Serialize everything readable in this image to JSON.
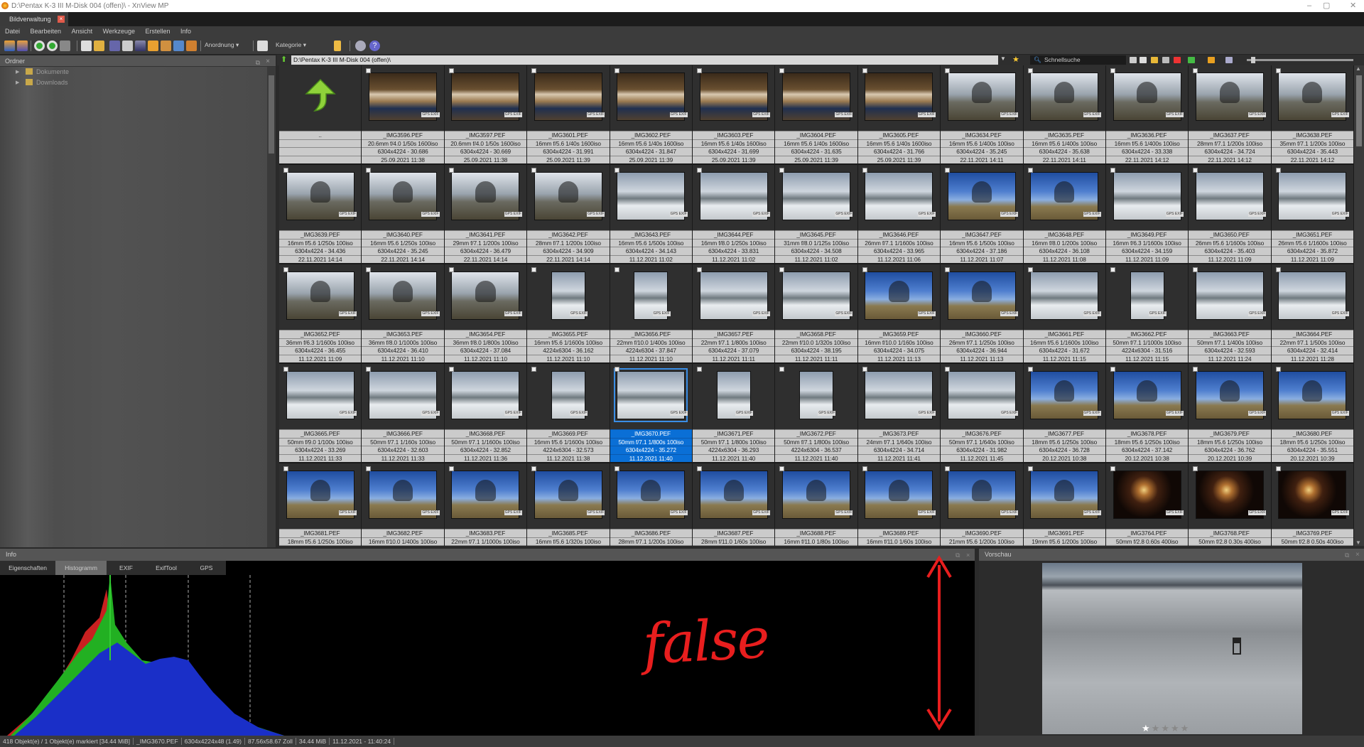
{
  "window": {
    "title": "D:\\Pentax K-3 III M-Disk 004 (offen)\\ - XnView MP",
    "minimize": "–",
    "maximize": "▢",
    "close": "✕"
  },
  "tab": {
    "label": "Bildverwaltung",
    "close": "×"
  },
  "menu": [
    "Datei",
    "Bearbeiten",
    "Ansicht",
    "Werkzeuge",
    "Erstellen",
    "Info"
  ],
  "toolbar": {
    "arrange_label": "Anordnung ▾",
    "category_label": "Kategorie ▾"
  },
  "folders": {
    "title": "Ordner",
    "items": [
      "Dokumente",
      "Downloads"
    ]
  },
  "pathbar": {
    "path": "D:\\Pentax K-3 III M-Disk 004 (offen)\\",
    "search_placeholder": "Schnellsuche"
  },
  "browser": {
    "parent_label": "..",
    "selected": "_IMG3670.PEF",
    "items": [
      [
        "_IMG3596.PEF",
        "20.6mm f/4.0 1/50s 1600iso",
        "6304x4224 - 30.686",
        "25.09.2021 11:38"
      ],
      [
        "_IMG3597.PEF",
        "20.6mm f/4.0 1/50s 1600iso",
        "6304x4224 - 30.669",
        "25.09.2021 11:38"
      ],
      [
        "_IMG3601.PEF",
        "16mm f/5.6 1/40s 1600iso",
        "6304x4224 - 31.991",
        "25.09.2021 11:39"
      ],
      [
        "_IMG3602.PEF",
        "16mm f/5.6 1/40s 1600iso",
        "6304x4224 - 31.847",
        "25.09.2021 11:39"
      ],
      [
        "_IMG3603.PEF",
        "16mm f/5.6 1/40s 1600iso",
        "6304x4224 - 31.699",
        "25.09.2021 11:39"
      ],
      [
        "_IMG3604.PEF",
        "16mm f/5.6 1/40s 1600iso",
        "6304x4224 - 31.635",
        "25.09.2021 11:39"
      ],
      [
        "_IMG3605.PEF",
        "16mm f/5.6 1/40s 1600iso",
        "6304x4224 - 31.766",
        "25.09.2021 11:39"
      ],
      [
        "_IMG3634.PEF",
        "16mm f/5.6 1/400s 100iso",
        "6304x4224 - 35.245",
        "22.11.2021 14:11"
      ],
      [
        "_IMG3635.PEF",
        "16mm f/5.6 1/400s 100iso",
        "6304x4224 - 35.638",
        "22.11.2021 14:11"
      ],
      [
        "_IMG3636.PEF",
        "16mm f/5.6 1/400s 100iso",
        "6304x4224 - 33.338",
        "22.11.2021 14:12"
      ],
      [
        "_IMG3637.PEF",
        "28mm f/7.1 1/200s 100iso",
        "6304x4224 - 34.724",
        "22.11.2021 14:12"
      ],
      [
        "_IMG3638.PEF",
        "35mm f/7.1 1/200s 100iso",
        "6304x4224 - 35.443",
        "22.11.2021 14:12"
      ],
      [
        "_IMG3639.PEF",
        "16mm f/5.6 1/250s 100iso",
        "6304x4224 - 34.436",
        "22.11.2021 14:14"
      ],
      [
        "_IMG3640.PEF",
        "16mm f/5.6 1/250s 100iso",
        "6304x4224 - 35.245",
        "22.11.2021 14:14"
      ],
      [
        "_IMG3641.PEF",
        "29mm f/7.1 1/200s 100iso",
        "6304x4224 - 36.479",
        "22.11.2021 14:14"
      ],
      [
        "_IMG3642.PEF",
        "28mm f/7.1 1/200s 100iso",
        "6304x4224 - 34.909",
        "22.11.2021 14:14"
      ],
      [
        "_IMG3643.PEF",
        "16mm f/5.6 1/500s 100iso",
        "6304x4224 - 34.143",
        "11.12.2021 11:02"
      ],
      [
        "_IMG3644.PEF",
        "16mm f/8.0 1/250s 100iso",
        "6304x4224 - 33.831",
        "11.12.2021 11:02"
      ],
      [
        "_IMG3645.PEF",
        "31mm f/8.0 1/125s 100iso",
        "6304x4224 - 34.508",
        "11.12.2021 11:02"
      ],
      [
        "_IMG3646.PEF",
        "26mm f/7.1 1/1600s 100iso",
        "6304x4224 - 33.965",
        "11.12.2021 11:06"
      ],
      [
        "_IMG3647.PEF",
        "16mm f/5.6 1/500s 100iso",
        "6304x4224 - 37.186",
        "11.12.2021 11:07"
      ],
      [
        "_IMG3648.PEF",
        "16mm f/8.0 1/200s 100iso",
        "6304x4224 - 36.108",
        "11.12.2021 11:08"
      ],
      [
        "_IMG3649.PEF",
        "16mm f/6.3 1/1600s 100iso",
        "6304x4224 - 34.159",
        "11.12.2021 11:09"
      ],
      [
        "_IMG3650.PEF",
        "26mm f/5.6 1/1600s 100iso",
        "6304x4224 - 35.403",
        "11.12.2021 11:09"
      ],
      [
        "_IMG3651.PEF",
        "26mm f/5.6 1/1600s 100iso",
        "6304x4224 - 35.872",
        "11.12.2021 11:09"
      ],
      [
        "_IMG3652.PEF",
        "36mm f/6.3 1/1600s 100iso",
        "6304x4224 - 36.455",
        "11.12.2021 11:09"
      ],
      [
        "_IMG3653.PEF",
        "36mm f/8.0 1/1000s 100iso",
        "6304x4224 - 36.410",
        "11.12.2021 11:10"
      ],
      [
        "_IMG3654.PEF",
        "36mm f/8.0 1/800s 100iso",
        "6304x4224 - 37.084",
        "11.12.2021 11:10"
      ],
      [
        "_IMG3655.PEF",
        "16mm f/5.6 1/1600s 100iso",
        "4224x6304 - 36.162",
        "11.12.2021 11:10"
      ],
      [
        "_IMG3656.PEF",
        "22mm f/10.0 1/400s 100iso",
        "4224x6304 - 37.847",
        "11.12.2021 11:10"
      ],
      [
        "_IMG3657.PEF",
        "22mm f/7.1 1/800s 100iso",
        "6304x4224 - 37.079",
        "11.12.2021 11:11"
      ],
      [
        "_IMG3658.PEF",
        "22mm f/10.0 1/320s 100iso",
        "6304x4224 - 38.195",
        "11.12.2021 11:11"
      ],
      [
        "_IMG3659.PEF",
        "16mm f/10.0 1/160s 100iso",
        "6304x4224 - 34.075",
        "11.12.2021 11:13"
      ],
      [
        "_IMG3660.PEF",
        "26mm f/7.1 1/250s 100iso",
        "6304x4224 - 36.944",
        "11.12.2021 11:13"
      ],
      [
        "_IMG3661.PEF",
        "16mm f/5.6 1/1600s 100iso",
        "6304x4224 - 31.672",
        "11.12.2021 11:15"
      ],
      [
        "_IMG3662.PEF",
        "50mm f/7.1 1/1000s 100iso",
        "4224x6304 - 31.516",
        "11.12.2021 11:15"
      ],
      [
        "_IMG3663.PEF",
        "50mm f/7.1 1/400s 100iso",
        "6304x4224 - 32.593",
        "11.12.2021 11:24"
      ],
      [
        "_IMG3664.PEF",
        "22mm f/7.1 1/500s 100iso",
        "6304x4224 - 32.414",
        "11.12.2021 11:28"
      ],
      [
        "_IMG3665.PEF",
        "50mm f/9.0 1/100s 100iso",
        "6304x4224 - 33.269",
        "11.12.2021 11:33"
      ],
      [
        "_IMG3666.PEF",
        "50mm f/7.1 1/160s 100iso",
        "6304x4224 - 32.603",
        "11.12.2021 11:33"
      ],
      [
        "_IMG3668.PEF",
        "50mm f/7.1 1/1600s 100iso",
        "6304x4224 - 32.852",
        "11.12.2021 11:36"
      ],
      [
        "_IMG3669.PEF",
        "16mm f/5.6 1/1600s 100iso",
        "4224x6304 - 32.573",
        "11.12.2021 11:38"
      ],
      [
        "_IMG3670.PEF",
        "50mm f/7.1 1/800s 100iso",
        "6304x4224 - 35.272",
        "11.12.2021 11:40"
      ],
      [
        "_IMG3671.PEF",
        "50mm f/7.1 1/800s 100iso",
        "4224x6304 - 36.293",
        "11.12.2021 11:40"
      ],
      [
        "_IMG3672.PEF",
        "50mm f/7.1 1/800s 100iso",
        "4224x6304 - 36.537",
        "11.12.2021 11:40"
      ],
      [
        "_IMG3673.PEF",
        "24mm f/7.1 1/640s 100iso",
        "6304x4224 - 34.714",
        "11.12.2021 11:41"
      ],
      [
        "_IMG3676.PEF",
        "50mm f/7.1 1/640s 100iso",
        "6304x4224 - 31.982",
        "11.12.2021 11:45"
      ],
      [
        "_IMG3677.PEF",
        "18mm f/5.6 1/250s 100iso",
        "6304x4224 - 36.728",
        "20.12.2021 10:38"
      ],
      [
        "_IMG3678.PEF",
        "18mm f/5.6 1/250s 100iso",
        "6304x4224 - 37.142",
        "20.12.2021 10:38"
      ],
      [
        "_IMG3679.PEF",
        "18mm f/5.6 1/250s 100iso",
        "6304x4224 - 36.762",
        "20.12.2021 10:39"
      ],
      [
        "_IMG3680.PEF",
        "18mm f/5.6 1/250s 100iso",
        "6304x4224 - 35.551",
        "20.12.2021 10:39"
      ],
      [
        "_IMG3681.PEF",
        "18mm f/5.6 1/250s 100iso"
      ],
      [
        "_IMG3682.PEF",
        "16mm f/10.0 1/400s 100iso"
      ],
      [
        "_IMG3683.PEF",
        "22mm f/7.1 1/1000s 100iso"
      ],
      [
        "_IMG3685.PEF",
        "16mm f/5.6 1/320s 100iso"
      ],
      [
        "_IMG3686.PEF",
        "28mm f/7.1 1/200s 100iso"
      ],
      [
        "_IMG3687.PEF",
        "28mm f/11.0 1/60s 100iso"
      ],
      [
        "_IMG3688.PEF",
        "16mm f/11.0 1/80s 100iso"
      ],
      [
        "_IMG3689.PEF",
        "16mm f/11.0 1/60s 100iso"
      ],
      [
        "_IMG3690.PEF",
        "21mm f/5.6 1/200s 100iso"
      ],
      [
        "_IMG3691.PEF",
        "19mm f/5.6 1/200s 100iso"
      ],
      [
        "_IMG3764.PEF",
        "50mm f/2.8 0.60s 400iso"
      ],
      [
        "_IMG3768.PEF",
        "50mm f/2.8 0.30s 400iso"
      ],
      [
        "_IMG3769.PEF",
        "50mm f/2.8 0.50s 400iso"
      ]
    ],
    "badges": {
      "gps": "GPS",
      "exif": "EXIF"
    }
  },
  "info": {
    "title": "Info",
    "tabs": [
      "Eigenschaften",
      "Histogramm",
      "EXIF",
      "ExifTool",
      "GPS"
    ],
    "active_tab": "Histogramm"
  },
  "preview": {
    "title": "Vorschau",
    "rating": 1,
    "rating_max": 5
  },
  "statusbar": [
    "418 Objekt(e) / 1 Objekt(e) markiert [34.44 MiB]",
    "_IMG3670.PEF",
    "6304x4224x48 (1.49)",
    "87.56x58.67 Zoll",
    "34.44 MiB",
    "11.12.2021 - 11:40:24"
  ],
  "annotation": {
    "text": "false",
    "color": "#e81e1e"
  },
  "colors": {
    "selection": "#0a6fd6",
    "histogram_blue": "#1a2fc8",
    "histogram_green": "#22c022",
    "histogram_red": "#d01818"
  }
}
